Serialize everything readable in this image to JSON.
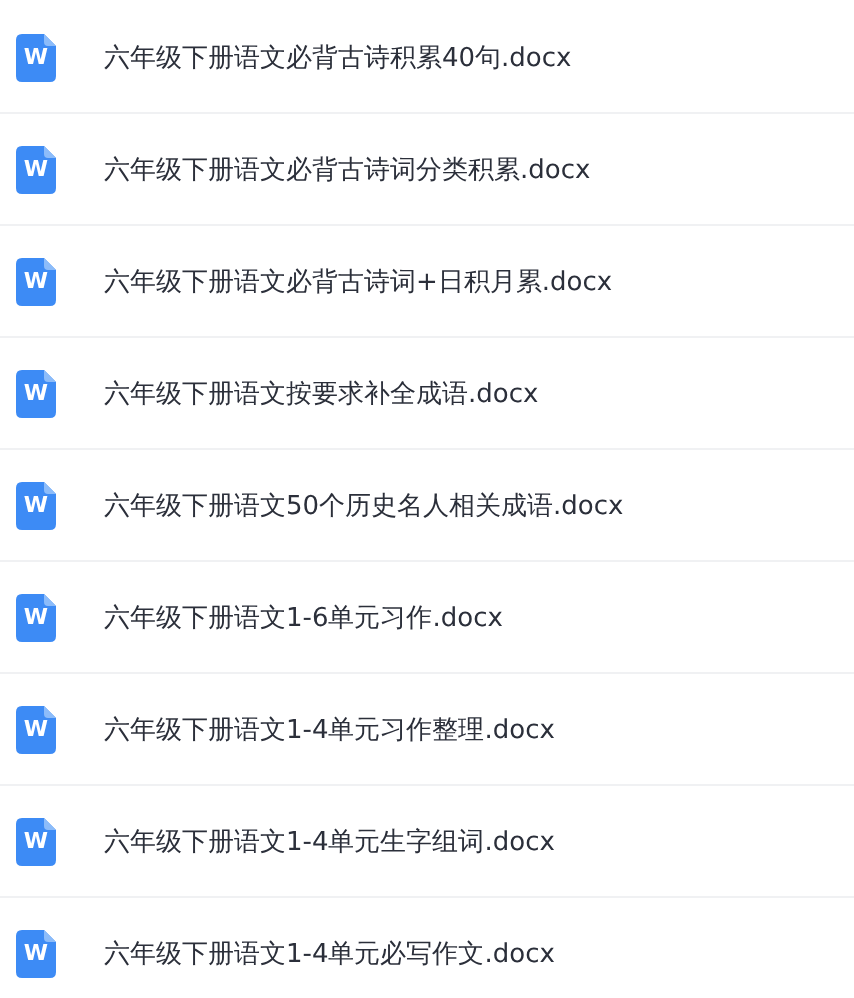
{
  "files": [
    {
      "icon_letter": "W",
      "name": "六年级下册语文必背古诗积累40句.docx"
    },
    {
      "icon_letter": "W",
      "name": "六年级下册语文必背古诗词分类积累.docx"
    },
    {
      "icon_letter": "W",
      "name": "六年级下册语文必背古诗词+日积月累.docx"
    },
    {
      "icon_letter": "W",
      "name": "六年级下册语文按要求补全成语.docx"
    },
    {
      "icon_letter": "W",
      "name": "六年级下册语文50个历史名人相关成语.docx"
    },
    {
      "icon_letter": "W",
      "name": "六年级下册语文1-6单元习作.docx"
    },
    {
      "icon_letter": "W",
      "name": "六年级下册语文1-4单元习作整理.docx"
    },
    {
      "icon_letter": "W",
      "name": "六年级下册语文1-4单元生字组词.docx"
    },
    {
      "icon_letter": "W",
      "name": "六年级下册语文1-4单元必写作文.docx"
    }
  ]
}
